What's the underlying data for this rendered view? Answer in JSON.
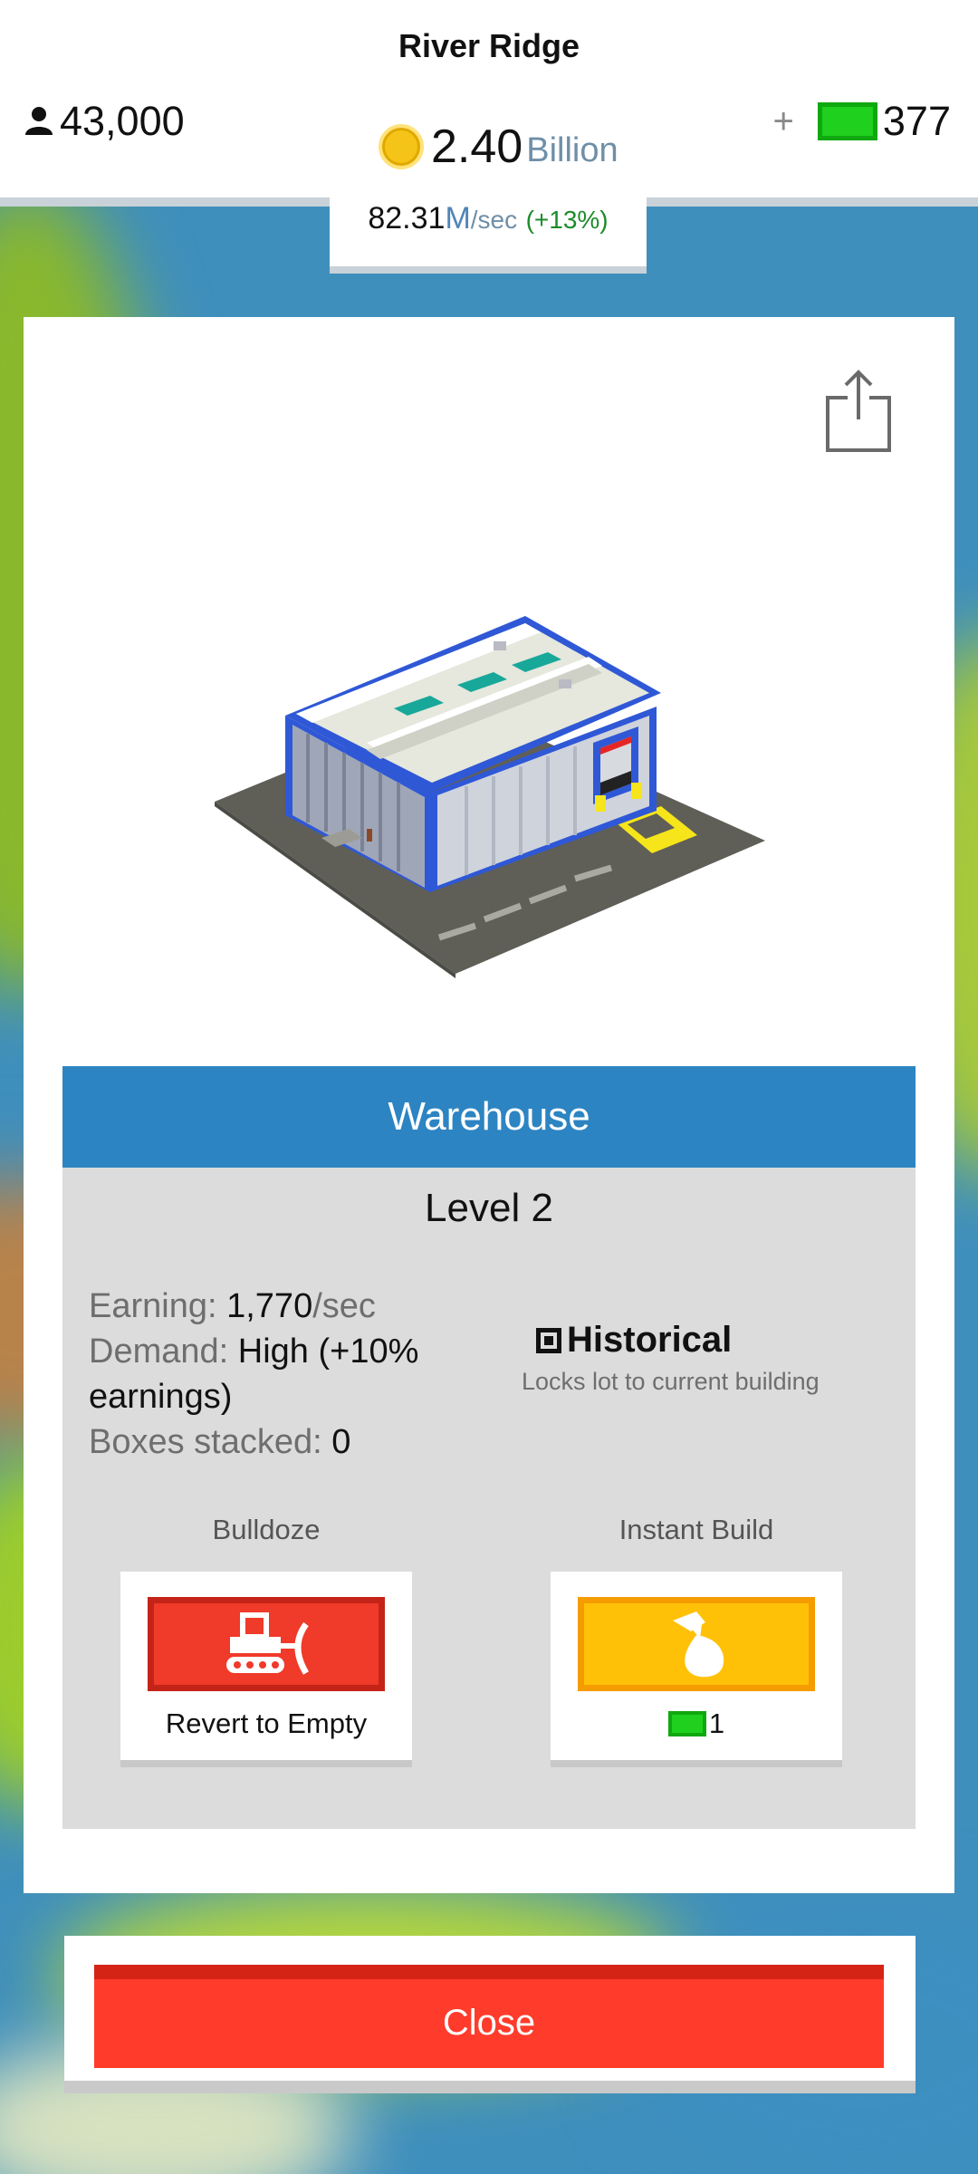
{
  "header": {
    "city_name": "River Ridge",
    "population": "43,000",
    "money_value": "2.40",
    "money_unit": "Billion",
    "cash_plus": "+",
    "cash_value": "377",
    "income_value": "82.31",
    "income_unit": "M",
    "income_per": "/sec",
    "income_bonus": "(+13%)"
  },
  "building": {
    "name": "Warehouse",
    "level": "Level 2",
    "stats": {
      "earning_label": "Earning:",
      "earning_value": "1,770",
      "earning_unit": "/sec",
      "demand_label": "Demand:",
      "demand_value": "High (+10% earnings)",
      "boxes_label": "Boxes stacked:",
      "boxes_value": "0"
    },
    "historical": {
      "label": "Historical",
      "description": "Locks lot to current building"
    }
  },
  "actions": {
    "bulldoze": {
      "title": "Bulldoze",
      "button_label": "Revert to Empty",
      "color": "#f03a2a"
    },
    "instant_build": {
      "title": "Instant Build",
      "cost": "1",
      "color": "#ffc107"
    }
  },
  "close_label": "Close",
  "icons": [
    "person-icon",
    "coin-icon",
    "cash-icon",
    "share-icon",
    "bulldozer-icon",
    "hammer-icon"
  ]
}
